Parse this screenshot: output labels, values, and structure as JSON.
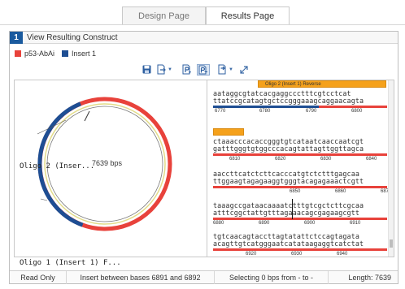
{
  "tabs": [
    {
      "label": "Design Page",
      "active": false
    },
    {
      "label": "Results Page",
      "active": true
    }
  ],
  "panel": {
    "step_number": "1",
    "title": "View Resulting Construct"
  },
  "legend": [
    {
      "label": "p53-AbAi",
      "color": "#e8423b"
    },
    {
      "label": "Insert 1",
      "color": "#1e4e93"
    }
  ],
  "toolbar": {
    "icons": [
      "save-icon",
      "export-dropdown-icon",
      "show-features-icon",
      "show-sequence-icon",
      "copy-dropdown-icon",
      "expand-icon"
    ]
  },
  "map": {
    "total_label": "7639 bps",
    "label_oligo2": "Oligo 2 (Inser...",
    "label_oligo1": "Oligo 1 (Insert 1) F..."
  },
  "sequence": {
    "feature_label": "Oligo 2 (Insert 1) Reverse",
    "rows": [
      {
        "top": "aataggcgtatcacgaggccctttcgtcctcat",
        "bottom": "ttatccgcatagtgctccgggaaagcaggaacagta",
        "ticks": [
          "6770",
          "6780",
          "6790",
          "6800"
        ]
      },
      {
        "top": "ctaaacccacaccgggtgtcataatcaaccaatcgt",
        "bottom": "gatttgggtgtggcccacagtattagttggttagca",
        "ticks": [
          "6810",
          "6820",
          "6830",
          "6840"
        ]
      },
      {
        "top": "aaccttcatctcttcacccatgtctctttgagcaa",
        "bottom": "ttggaagtagagaaggtgggtacagagaaactcgtt",
        "ticks": [
          "6850",
          "6860",
          "6870"
        ]
      },
      {
        "top": "taaagccgataacaaaatctttgtcgctcttcgcaa",
        "bottom": "atttcggctattgtttagaaacagcgagaagcgtt",
        "ticks": [
          "6880",
          "6890",
          "6900",
          "6910"
        ]
      },
      {
        "top": "tgtcaacagtaccttagtatattctccagtagata",
        "bottom": "acagttgtcatgggaatcatataagaggtcatctat",
        "ticks": [
          "6920",
          "6930",
          "6940"
        ]
      }
    ]
  },
  "status": {
    "mode": "Read Only",
    "insert": "Insert between bases 6891 and 6892",
    "selection": "Selecting 0 bps from - to -",
    "length": "Length: 7639"
  },
  "colors": {
    "backbone": "#e8423b",
    "insert": "#1e4e93",
    "feature": "#f5a11b",
    "accent": "#1a5a9e"
  }
}
